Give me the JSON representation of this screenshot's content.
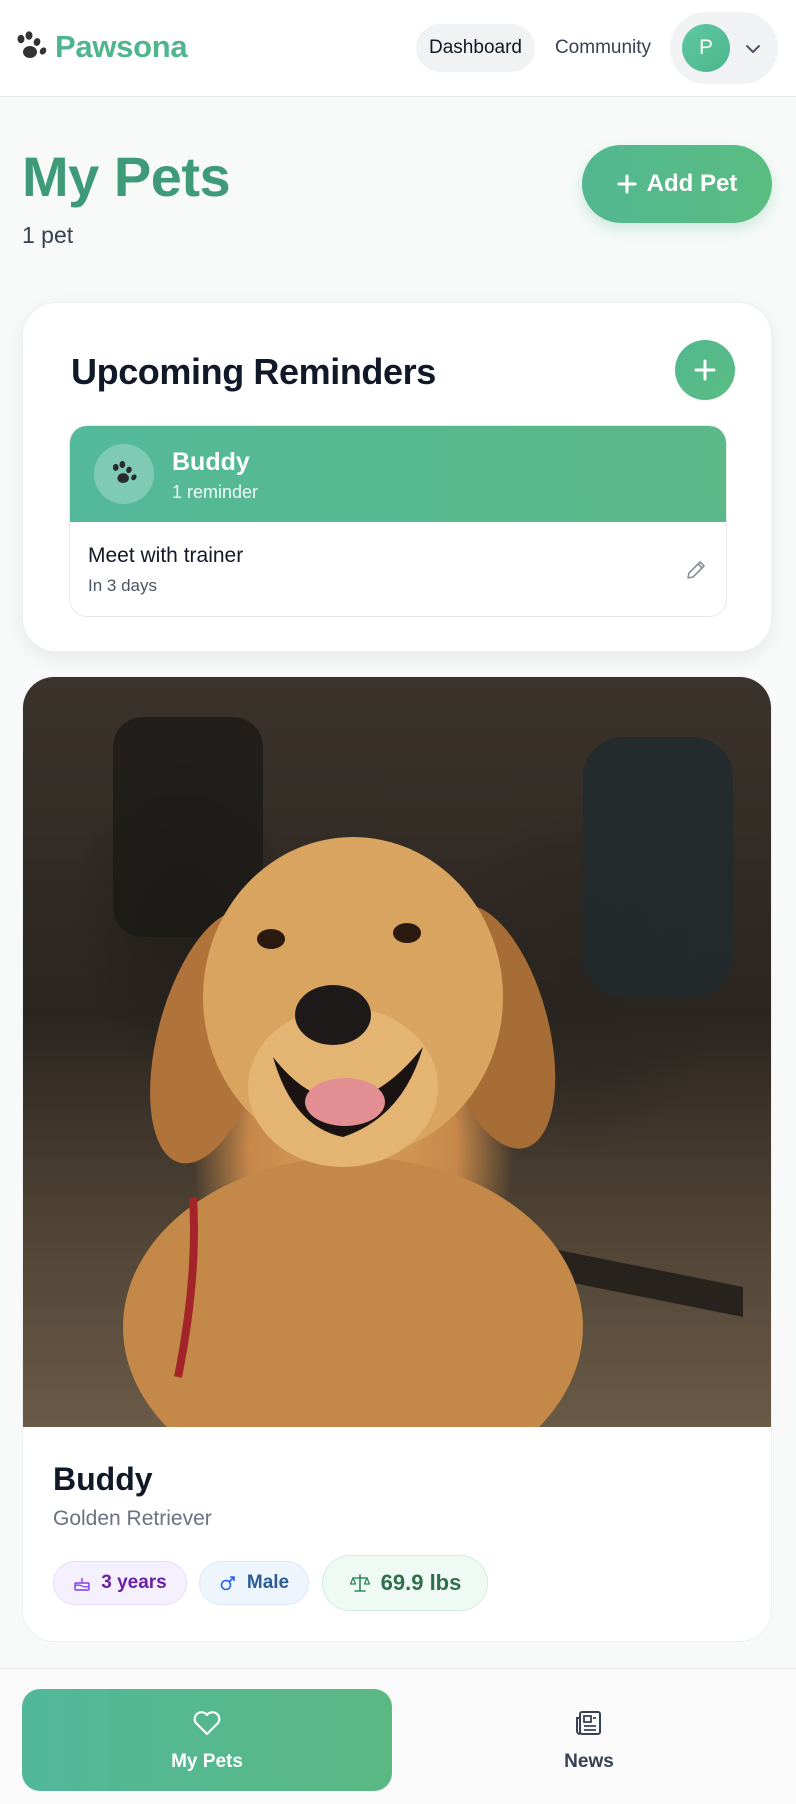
{
  "header": {
    "brand": "Pawsona",
    "nav": {
      "dashboard": "Dashboard",
      "community": "Community"
    },
    "user_initial": "P"
  },
  "page": {
    "title": "My Pets",
    "pet_count": "1 pet",
    "add_pet_label": "Add Pet"
  },
  "reminders": {
    "title": "Upcoming Reminders",
    "groups": [
      {
        "pet_name": "Buddy",
        "count_text": "1 reminder",
        "items": [
          {
            "title": "Meet with trainer",
            "when": "In 3 days"
          }
        ]
      }
    ]
  },
  "pets": [
    {
      "name": "Buddy",
      "breed": "Golden Retriever",
      "age": "3 years",
      "sex": "Male",
      "weight": "69.9 lbs",
      "photo": "golden retriever dog"
    }
  ],
  "bottom_nav": {
    "tabs": [
      {
        "label": "My Pets",
        "icon": "heart-icon",
        "active": true
      },
      {
        "label": "News",
        "icon": "newspaper-icon",
        "active": false
      }
    ]
  },
  "colors": {
    "brand": "#4fb58f",
    "title": "#3f9a79",
    "accent_gradient_start": "#52b792",
    "accent_gradient_end": "#5abd80"
  }
}
